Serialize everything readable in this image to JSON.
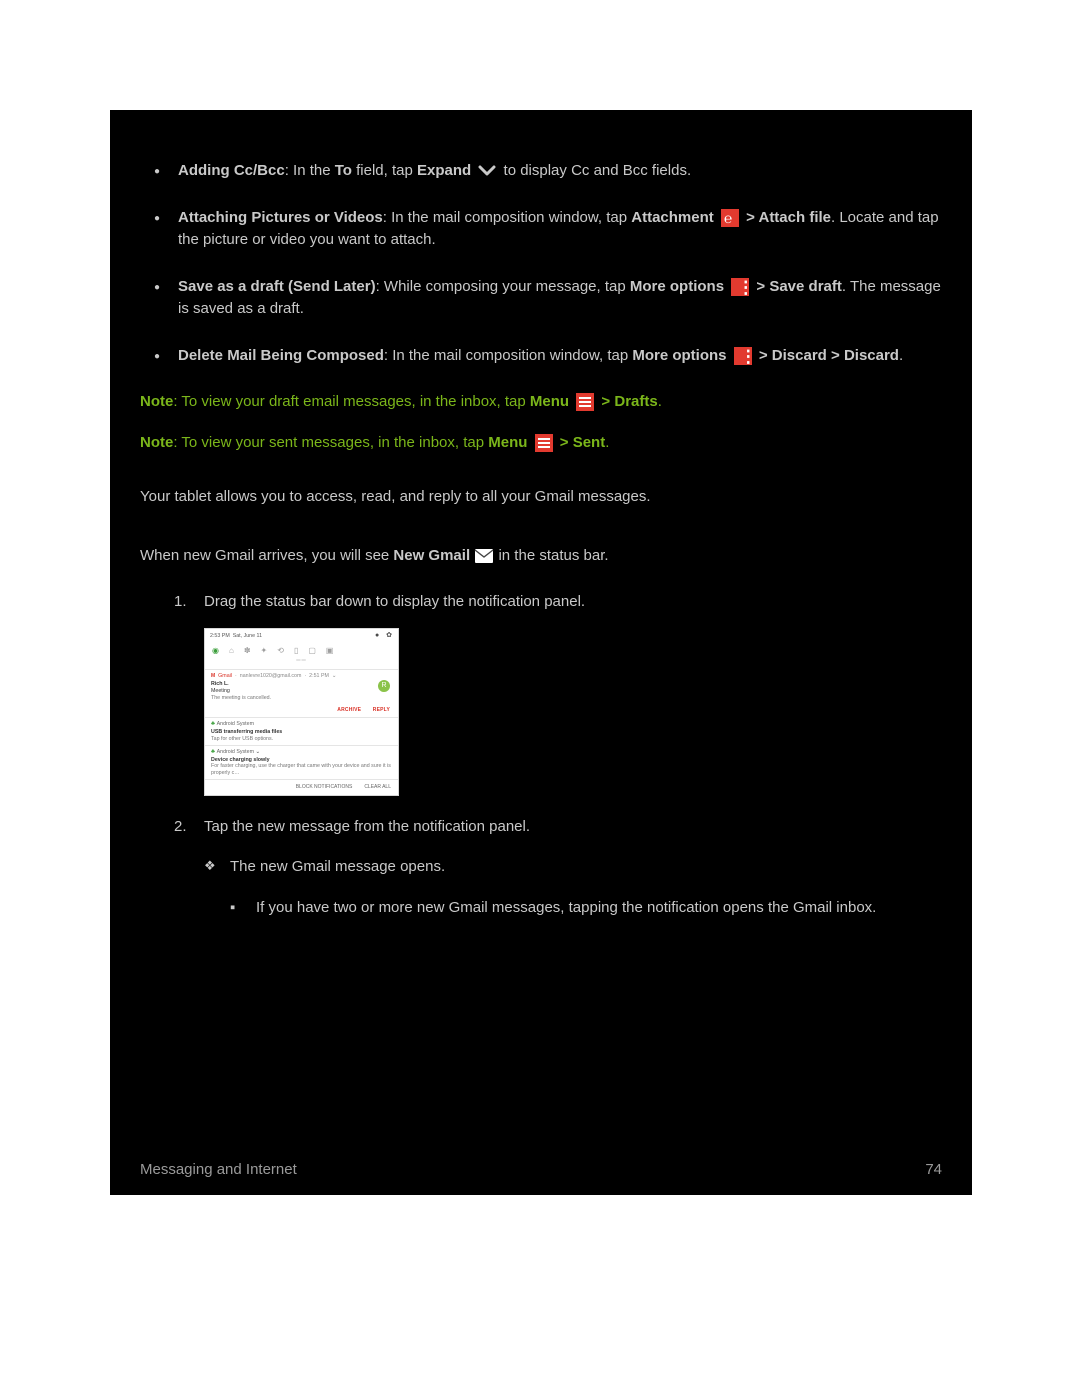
{
  "bullets": {
    "b1": {
      "label": "Adding Cc/Bcc",
      "t1": ": In the ",
      "to": "To",
      "t2": " field, tap ",
      "expand": "Expand",
      "t3": " to display Cc and Bcc fields."
    },
    "b2": {
      "label": "Attaching Pictures or Videos",
      "t1": ": In the mail composition window, tap ",
      "attachment": "Attachment",
      "gt": " > ",
      "attachfile": "Attach file",
      "t2": ". Locate and tap the picture or video you want to attach."
    },
    "b3": {
      "label": "Save as a draft (Send Later)",
      "t1": ": While composing your message, tap ",
      "moreopts": "More options",
      "gt": " > ",
      "savedraft": "Save draft",
      "t2": ". The message is saved as a draft."
    },
    "b4": {
      "label": "Delete Mail Being Composed",
      "t1": ": In the mail composition window, tap ",
      "moreopts": "More options",
      "gt1": " > ",
      "discard": "Discard",
      "gt2": " > ",
      "discard2": "Discard",
      "t2": "."
    }
  },
  "notes": {
    "n1": {
      "note": "Note",
      "t1": ": To view your draft email messages, in the inbox, tap ",
      "menu": "Menu",
      "gt": " > ",
      "drafts": "Drafts",
      "t2": "."
    },
    "n2": {
      "note": "Note",
      "t1": ": To view your sent messages, in the inbox, tap ",
      "menu": "Menu",
      "gt": " > ",
      "sent": "Sent",
      "t2": "."
    }
  },
  "intro": "Your tablet allows you to access, read, and reply to all your Gmail messages.",
  "newmail": {
    "t1": "When new Gmail arrives, you will see ",
    "label": "New Gmail",
    "t2": " in the status bar."
  },
  "steps": {
    "s1": "Drag the status bar down to display the notification panel.",
    "s2": "Tap the new message from the notification panel.",
    "diamond": "The new Gmail message opens.",
    "square": "If you have two or more new Gmail messages, tapping the notification opens the Gmail inbox."
  },
  "notif": {
    "time": "2:53 PM",
    "date": "Sat, June 11",
    "gmail_label": "Gmail",
    "gmail_acct": "nanlevre1020@gmail.com",
    "gmail_time": "2:51 PM",
    "sender": "Rich L.",
    "subject": "Meeting",
    "body": "The meeting is cancelled.",
    "avatar": "R",
    "archive": "ARCHIVE",
    "reply": "REPLY",
    "sys1_src": "Android System",
    "sys1_title": "USB transferring media files",
    "sys1_body": "Tap for other USB options.",
    "sys2_src": "Android System",
    "sys2_title": "Device charging slowly",
    "sys2_body": "For faster charging, use the charger that came with your device and sure it is properly c…",
    "block": "BLOCK NOTIFICATIONS",
    "clear": "CLEAR ALL"
  },
  "footer": {
    "section": "Messaging and Internet",
    "page": "74"
  }
}
